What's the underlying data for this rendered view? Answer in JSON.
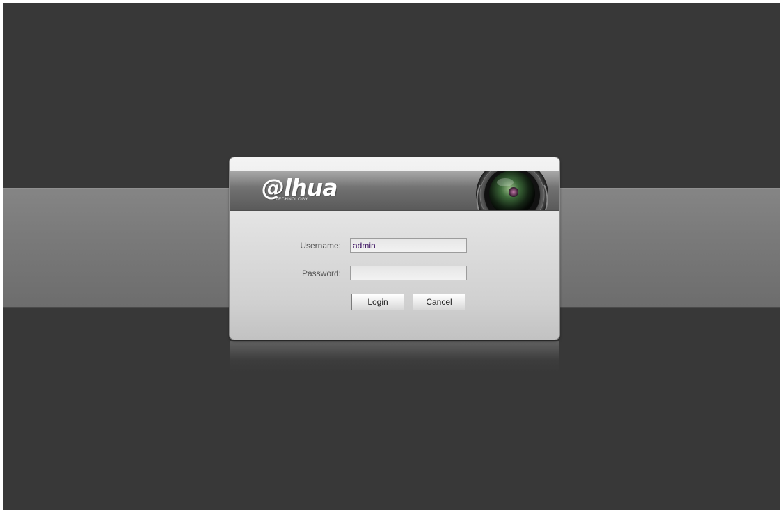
{
  "brand": {
    "logo_text": "@lhua",
    "logo_subtext": "TECHNOLOGY"
  },
  "login": {
    "username_label": "Username:",
    "username_value": "admin",
    "password_label": "Password:",
    "password_value": "",
    "login_button": "Login",
    "cancel_button": "Cancel"
  },
  "icons": {
    "camera_lens": "camera-lens-icon"
  },
  "colors": {
    "background": "#383838",
    "band": "#7a7a7a",
    "dialog": "#e2e2e2",
    "input_text": "#3a1060"
  }
}
